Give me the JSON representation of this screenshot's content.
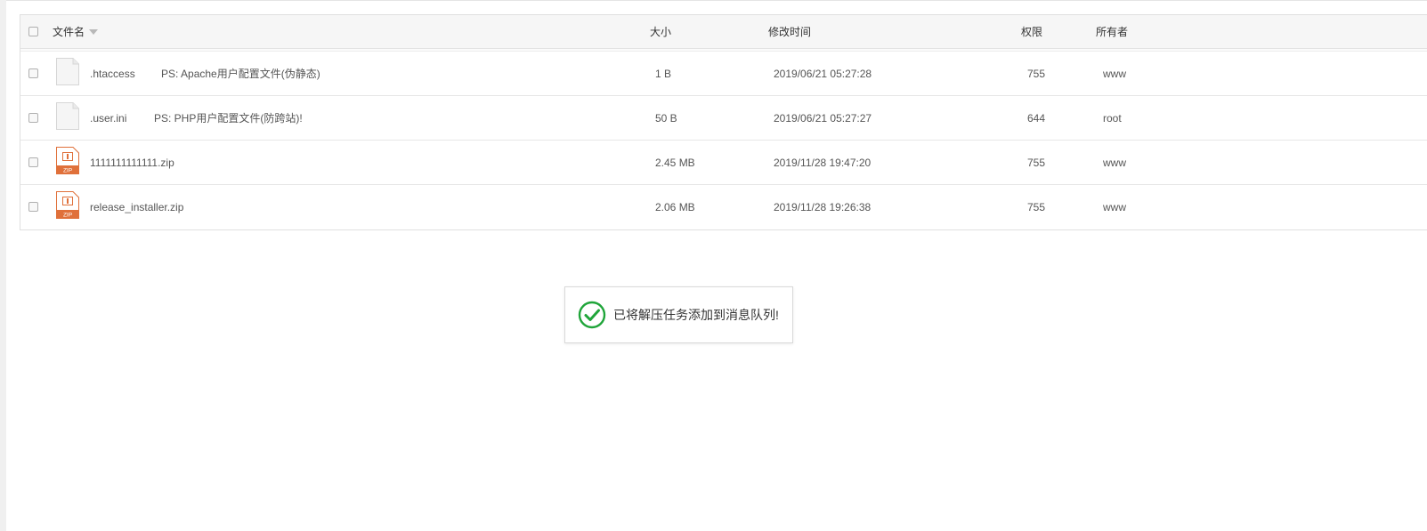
{
  "table": {
    "headers": {
      "name": "文件名",
      "size": "大小",
      "mtime": "修改时间",
      "perm": "权限",
      "owner": "所有者"
    },
    "rows": [
      {
        "type": "file",
        "name": ".htaccess",
        "note": "PS: Apache用户配置文件(伪静态)",
        "size": "1 B",
        "mtime": "2019/06/21 05:27:28",
        "perm": "755",
        "owner": "www"
      },
      {
        "type": "file",
        "name": ".user.ini",
        "note": "PS: PHP用户配置文件(防跨站)!",
        "size": "50 B",
        "mtime": "2019/06/21 05:27:27",
        "perm": "644",
        "owner": "root"
      },
      {
        "type": "zip",
        "name": "1111111111111.zip",
        "note": "",
        "size": "2.45 MB",
        "mtime": "2019/11/28 19:47:20",
        "perm": "755",
        "owner": "www"
      },
      {
        "type": "zip",
        "name": "release_installer.zip",
        "note": "",
        "size": "2.06 MB",
        "mtime": "2019/11/28 19:26:38",
        "perm": "755",
        "owner": "www"
      }
    ],
    "zip_icon_label": "ZIP"
  },
  "toast": {
    "message": "已将解压任务添加到消息队列!",
    "icon": "check-circle-icon",
    "color": "#20a53a"
  },
  "colors": {
    "zip_icon": "#e0703a",
    "header_bg": "#f6f6f6"
  }
}
